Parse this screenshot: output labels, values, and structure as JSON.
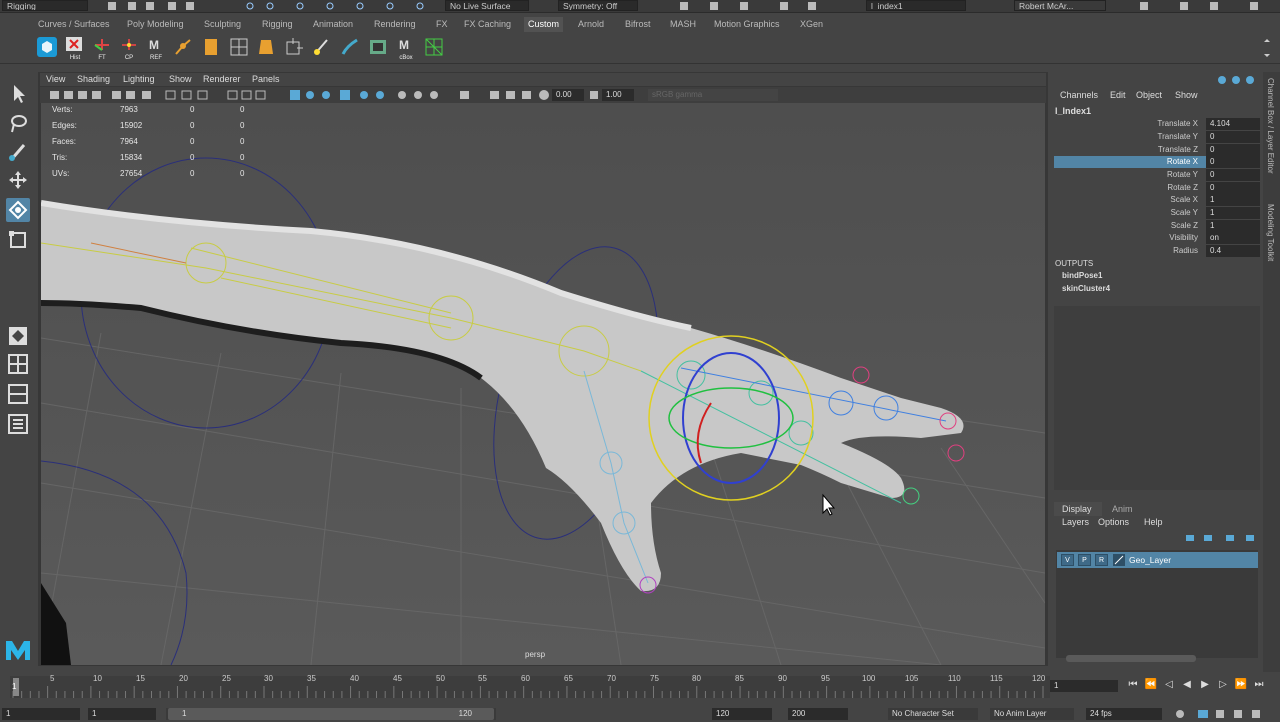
{
  "status_line": {
    "menu_set": "Rigging",
    "live_surface": "No Live Surface",
    "symmetry": "Symmetry: Off",
    "selected_object": "l_index1",
    "user": "Robert McAr..."
  },
  "shelf_tabs": [
    "Curves / Surfaces",
    "Poly Modeling",
    "Sculpting",
    "Rigging",
    "Animation",
    "Rendering",
    "FX",
    "FX Caching",
    "Custom",
    "Arnold",
    "Bifrost",
    "MASH",
    "Motion Graphics",
    "XGen"
  ],
  "active_shelf_tab": "Custom",
  "shelf_icon_captions": [
    "",
    "Hist",
    "FT",
    "CP",
    "REF",
    "",
    "",
    "",
    "",
    "",
    "",
    "",
    "cBox",
    ""
  ],
  "viewport": {
    "menus": [
      "View",
      "Shading",
      "Lighting",
      "Show",
      "Renderer",
      "Panels"
    ],
    "toolbar_values": {
      "field_a": "0.00",
      "field_b": "1.00",
      "color_space": "sRGB gamma"
    },
    "hud": [
      {
        "label": "Verts:",
        "v1": "7963",
        "v2": "0",
        "v3": "0"
      },
      {
        "label": "Edges:",
        "v1": "15902",
        "v2": "0",
        "v3": "0"
      },
      {
        "label": "Faces:",
        "v1": "7964",
        "v2": "0",
        "v3": "0"
      },
      {
        "label": "Tris:",
        "v1": "15834",
        "v2": "0",
        "v3": "0"
      },
      {
        "label": "UVs:",
        "v1": "27654",
        "v2": "0",
        "v3": "0"
      }
    ],
    "camera_label": "persp"
  },
  "channel_box": {
    "menus": [
      "Channels",
      "Edit",
      "Object",
      "Show"
    ],
    "object_name": "l_Index1",
    "attributes": [
      {
        "name": "Translate X",
        "value": "4.104"
      },
      {
        "name": "Translate Y",
        "value": "0"
      },
      {
        "name": "Translate Z",
        "value": "0"
      },
      {
        "name": "Rotate X",
        "value": "0"
      },
      {
        "name": "Rotate Y",
        "value": "0"
      },
      {
        "name": "Rotate Z",
        "value": "0"
      },
      {
        "name": "Scale X",
        "value": "1"
      },
      {
        "name": "Scale Y",
        "value": "1"
      },
      {
        "name": "Scale Z",
        "value": "1"
      },
      {
        "name": "Visibility",
        "value": "on"
      },
      {
        "name": "Radius",
        "value": "0.4"
      }
    ],
    "selected_attribute": "Rotate X",
    "outputs_label": "OUTPUTS",
    "outputs": [
      "bindPose1",
      "skinCluster4"
    ]
  },
  "side_tabs": [
    "Channel Box / Layer Editor",
    "Modeling Toolkit"
  ],
  "layer_editor": {
    "tabs": [
      "Display",
      "Anim"
    ],
    "menus": [
      "Layers",
      "Options",
      "Help"
    ],
    "layer": {
      "v": "V",
      "p": "P",
      "r": "R",
      "name": "Geo_Layer"
    }
  },
  "time_slider": {
    "ticks": [
      "1",
      "5",
      "10",
      "15",
      "20",
      "25",
      "30",
      "35",
      "40",
      "45",
      "50",
      "55",
      "60",
      "65",
      "70",
      "75",
      "80",
      "85",
      "90",
      "95",
      "100",
      "105",
      "110",
      "115",
      "120"
    ],
    "current_frame": "1"
  },
  "range_slider": {
    "start": "1",
    "inner_start": "1",
    "slider_start": "1",
    "slider_end": "120",
    "end": "120",
    "anim_end": "200",
    "character_set": "No Character Set",
    "anim_layer": "No Anim Layer",
    "fps": "24 fps"
  },
  "colors": {
    "accent": "#5285a6",
    "bg": "#444444",
    "viewport": "#555555"
  }
}
